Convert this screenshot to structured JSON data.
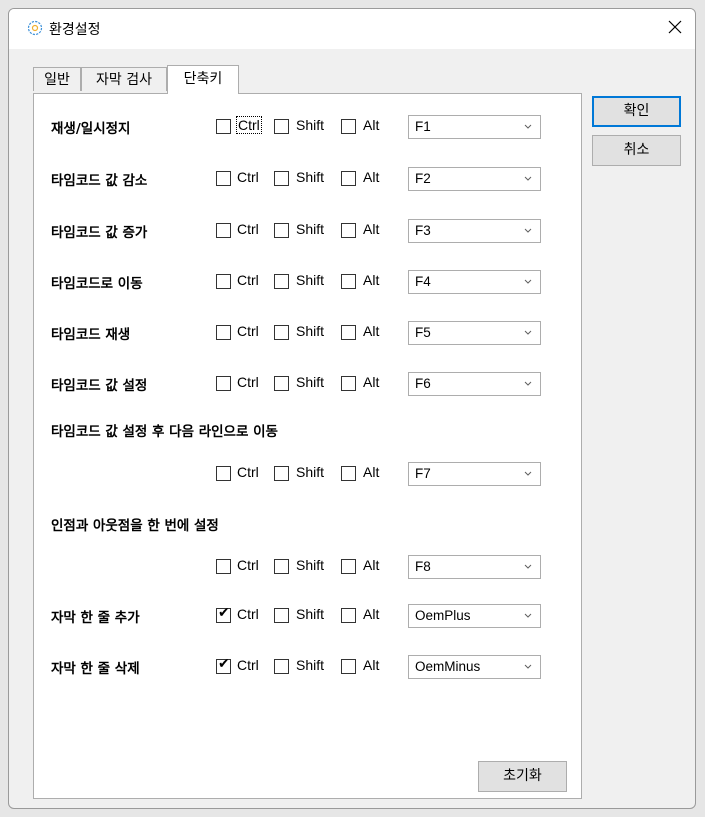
{
  "window": {
    "title": "환경설정",
    "close_glyph": "✕",
    "app_icon": "settings-app-icon"
  },
  "tabs": [
    {
      "label": "일반",
      "active": false
    },
    {
      "label": "자막 검사",
      "active": false
    },
    {
      "label": "단축키",
      "active": true
    }
  ],
  "buttons": {
    "ok": "확인",
    "cancel": "취소",
    "reset": "초기화"
  },
  "modifier_labels": {
    "ctrl": "Ctrl",
    "shift": "Shift",
    "alt": "Alt"
  },
  "shortcuts": [
    {
      "label": "재생/일시정지",
      "ctrl": false,
      "shift": false,
      "alt": false,
      "key": "F1"
    },
    {
      "label": "타임코드 값 감소",
      "ctrl": false,
      "shift": false,
      "alt": false,
      "key": "F2"
    },
    {
      "label": "타임코드 값 증가",
      "ctrl": false,
      "shift": false,
      "alt": false,
      "key": "F3"
    },
    {
      "label": "타임코드로 이동",
      "ctrl": false,
      "shift": false,
      "alt": false,
      "key": "F4"
    },
    {
      "label": "타임코드 재생",
      "ctrl": false,
      "shift": false,
      "alt": false,
      "key": "F5"
    },
    {
      "label": "타임코드 값 설정",
      "ctrl": false,
      "shift": false,
      "alt": false,
      "key": "F6"
    },
    {
      "label": "타임코드 값 설정 후 다음 라인으로 이동",
      "ctrl": false,
      "shift": false,
      "alt": false,
      "key": "F7"
    },
    {
      "label": "인점과 아웃점을 한 번에 설정",
      "ctrl": false,
      "shift": false,
      "alt": false,
      "key": "F8"
    },
    {
      "label": "자막 한 줄 추가",
      "ctrl": true,
      "shift": false,
      "alt": false,
      "key": "OemPlus"
    },
    {
      "label": "자막 한 줄 삭제",
      "ctrl": true,
      "shift": false,
      "alt": false,
      "key": "OemMinus"
    }
  ],
  "check_glyph": "✔",
  "colors": {
    "accent": "#0078d7",
    "window_bg": "#f0f0f0",
    "panel_bg": "#ffffff",
    "border": "#adadad"
  }
}
